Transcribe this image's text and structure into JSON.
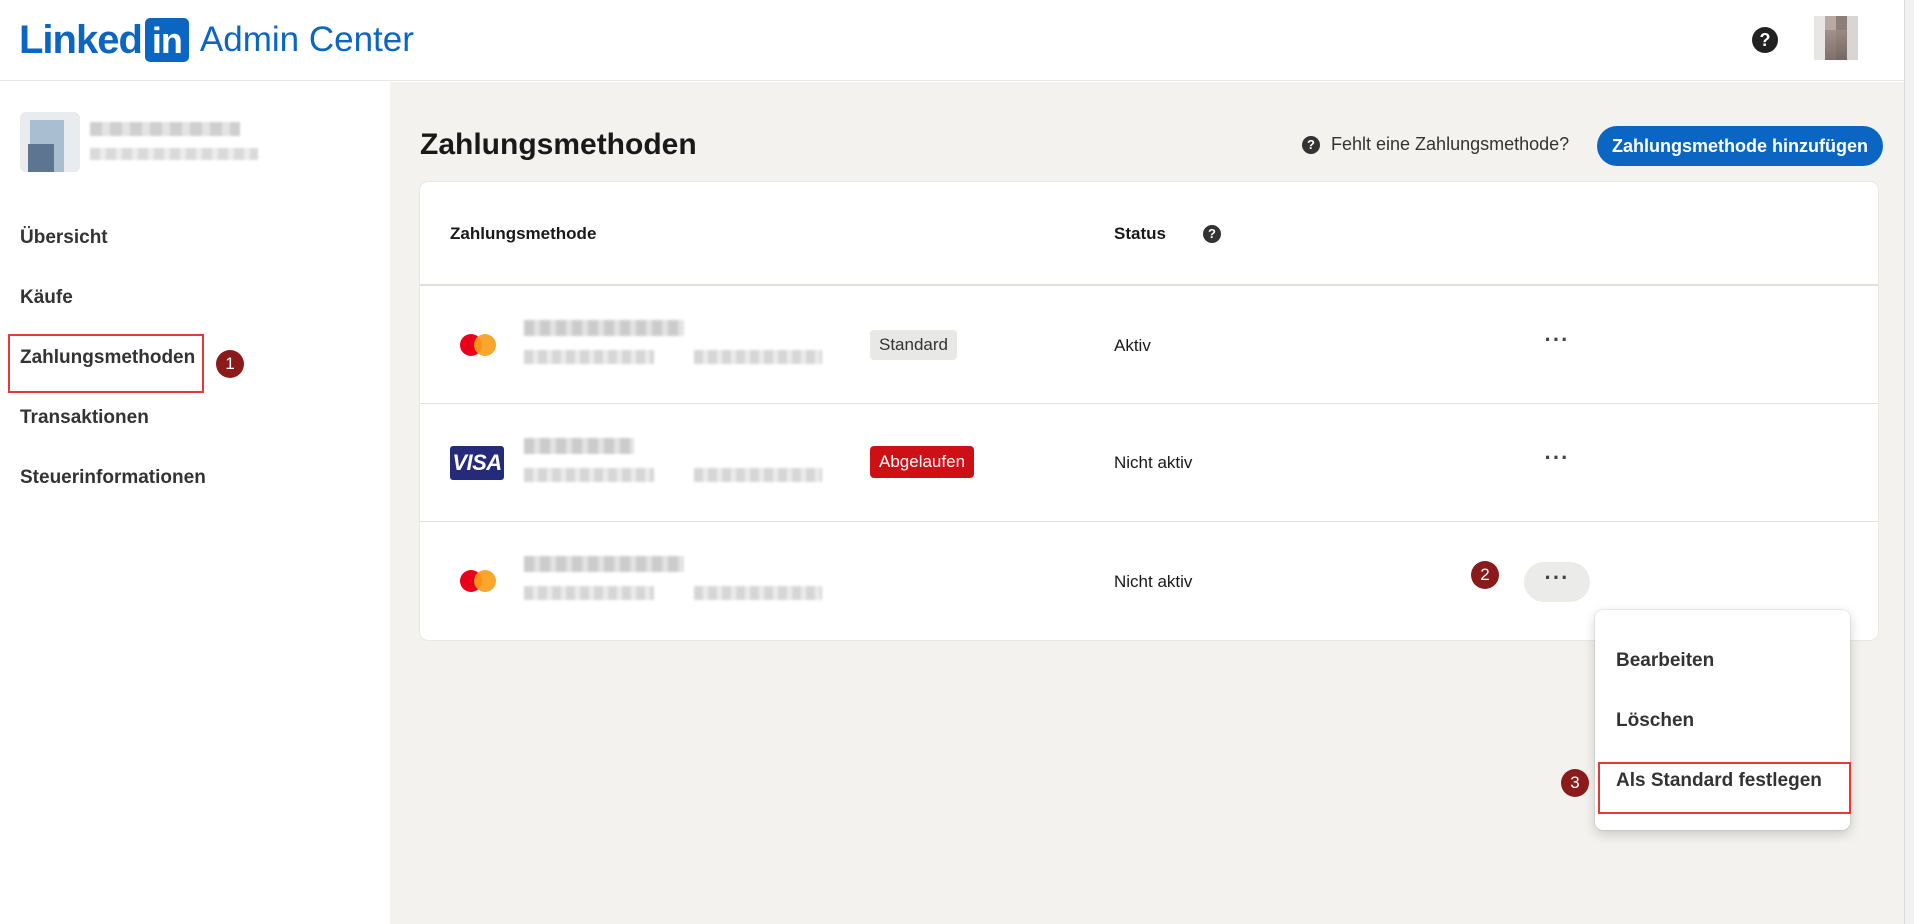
{
  "header": {
    "logo_linked": "Linked",
    "logo_in": "in",
    "app_name": "Admin Center",
    "help_icon": "question-circle-icon"
  },
  "sidebar": {
    "items": [
      {
        "label": "Übersicht"
      },
      {
        "label": "Käufe"
      },
      {
        "label": "Zahlungsmethoden",
        "active": true
      },
      {
        "label": "Transaktionen"
      },
      {
        "label": "Steuerinformationen"
      }
    ]
  },
  "steps": [
    "1",
    "2",
    "3"
  ],
  "main": {
    "title": "Zahlungsmethoden",
    "missing_link": "Fehlt eine Zahlungsmethode?",
    "add_button": "Zahlungsmethode hinzufügen",
    "table": {
      "columns": [
        "Zahlungsmethode",
        "Status"
      ],
      "rows": [
        {
          "brand": "mastercard",
          "badge": "Standard",
          "status": "Aktiv"
        },
        {
          "brand": "visa",
          "brand_label": "VISA",
          "badge": "Abgelaufen",
          "status": "Nicht aktiv"
        },
        {
          "brand": "mastercard",
          "badge": "",
          "status": "Nicht aktiv"
        }
      ],
      "more_label": "···"
    }
  },
  "dropdown": {
    "items": [
      "Bearbeiten",
      "Löschen",
      "Als Standard festlegen"
    ]
  },
  "colors": {
    "brand": "#0a66c2",
    "expired": "#cc1016",
    "step_badge": "#8b1a1a",
    "highlight": "#e53935"
  }
}
